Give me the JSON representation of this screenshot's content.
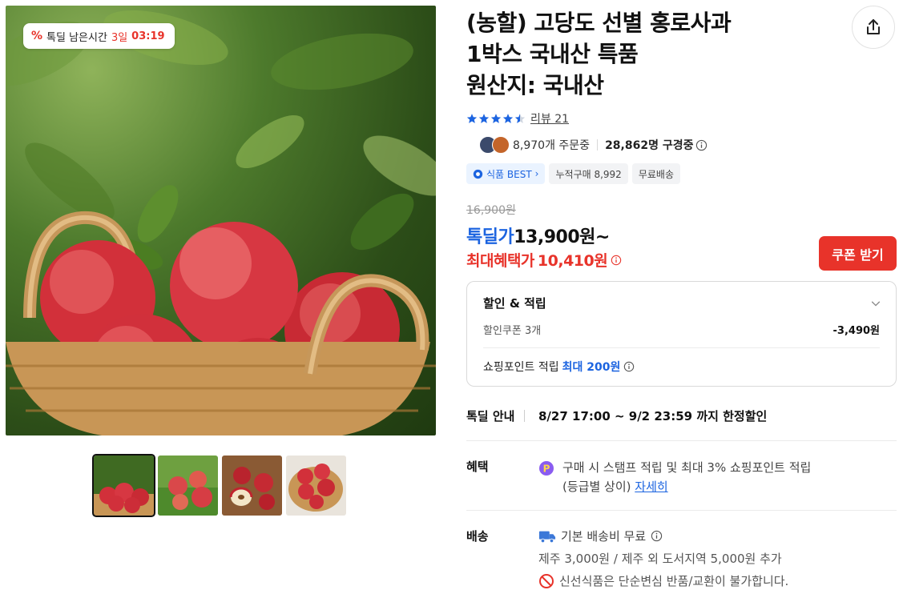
{
  "gallery": {
    "timer_label": "톡딜 남은시간",
    "timer_days": "3일",
    "timer_time": "03:19",
    "thumbnail_count": 4
  },
  "product": {
    "title_line1": "(농할) 고당도 선별 홍로사과",
    "title_line2": "1박스 국내산 특품",
    "title_line3": "원산지: 국내산",
    "rating": 4.5,
    "review_link": "리뷰 21",
    "orders_text": "8,970개 주문중",
    "viewers_text": "28,862명 구경중",
    "badge_best": "식품 BEST",
    "badge_cumulative": "누적구매 8,992",
    "badge_shipping": "무료배송"
  },
  "price": {
    "original": "16,900원",
    "deal_label": "톡딜가",
    "deal_value": "13,900원~",
    "max_label": "최대혜택가",
    "max_value": "10,410원",
    "coupon_button": "쿠폰 받기"
  },
  "discount": {
    "header": "할인 & 적립",
    "coupon_label": "할인쿠폰 3개",
    "coupon_amount": "-3,490원",
    "point_label": "쇼핑포인트 적립",
    "point_value": "최대 200원"
  },
  "deal_info": {
    "label": "톡딜 안내",
    "period": "8/27 17:00 ~ 9/2 23:59 까지 한정할인"
  },
  "benefit": {
    "label": "혜택",
    "text_line1": "구매 시 스탬프 적립 및 최대 3% 쇼핑포인트 적립",
    "text_line2": "(등급별 상이)",
    "link": "자세히"
  },
  "shipping": {
    "label": "배송",
    "line1": "기본 배송비 무료",
    "line2": "제주 3,000원 / 제주 외 도서지역 5,000원 추가",
    "line3": "신선식품은 단순변심 반품/교환이 불가합니다."
  },
  "colors": {
    "accent_red": "#e8332a",
    "accent_blue": "#1c64e0"
  }
}
